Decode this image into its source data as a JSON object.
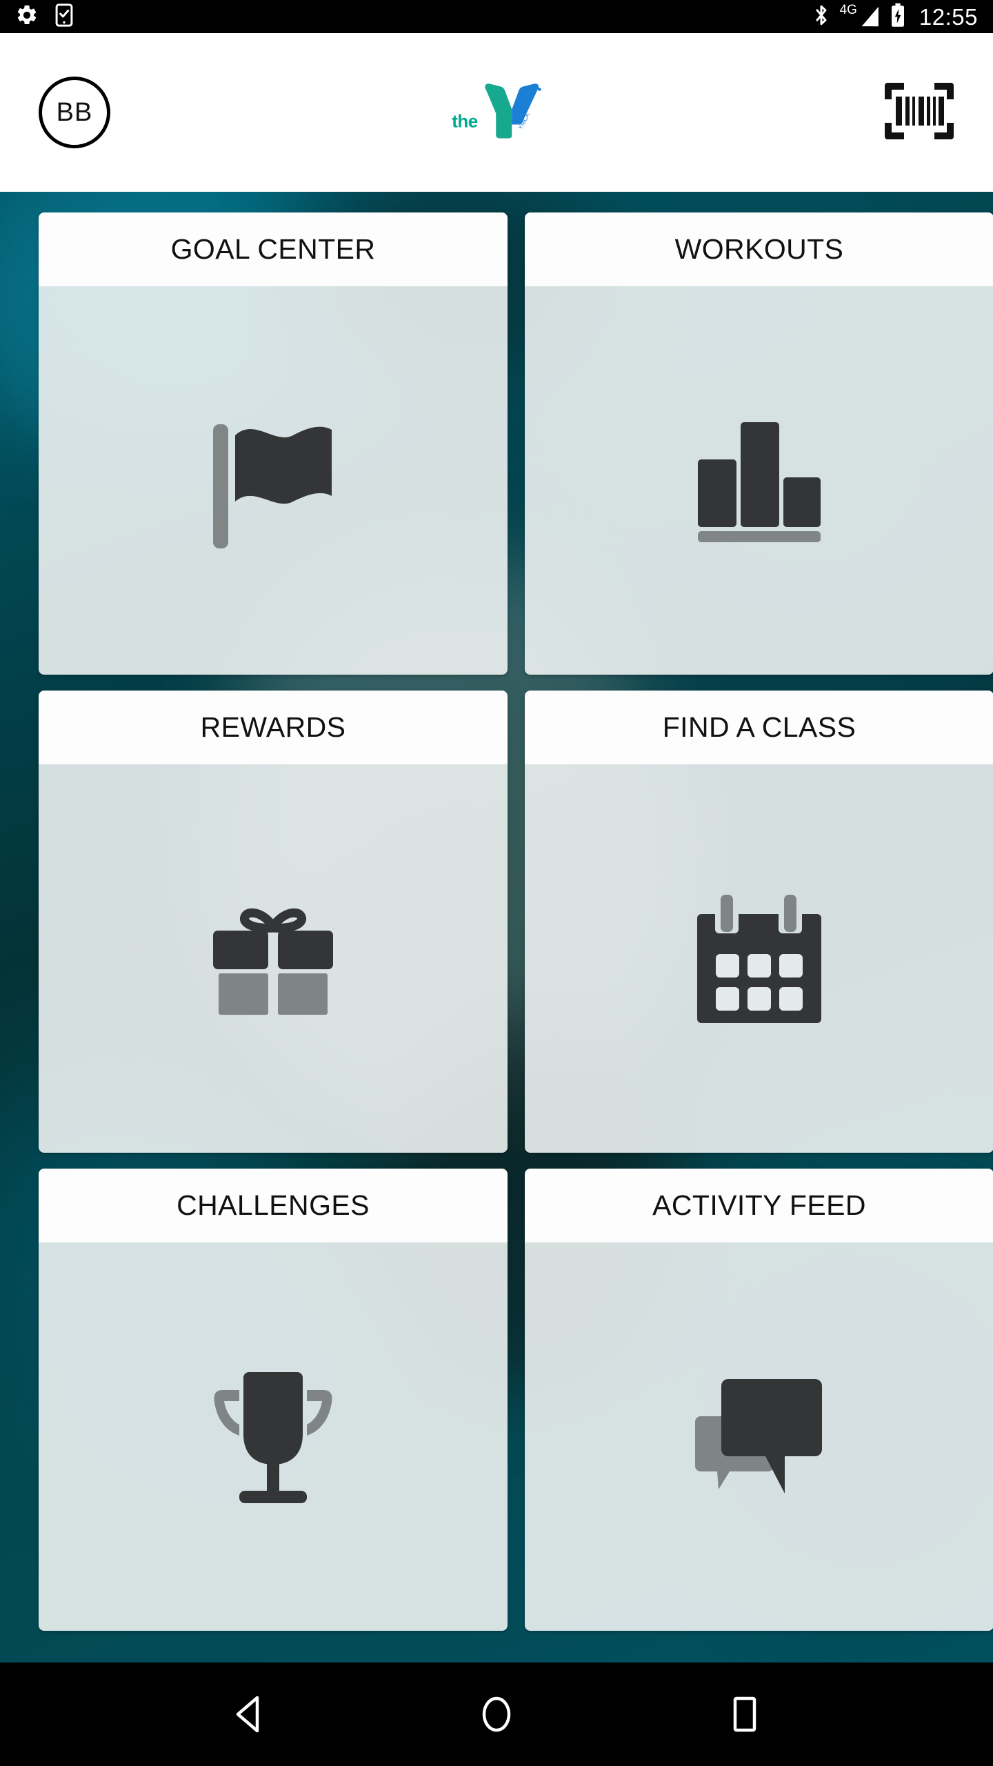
{
  "status_bar": {
    "time": "12:55",
    "network_label": "4G",
    "left_icons": [
      "settings-gear-icon",
      "phone-checkmark-icon"
    ],
    "right_icons": [
      "bluetooth-icon",
      "signal-bars-icon",
      "battery-charging-icon"
    ]
  },
  "app_header": {
    "avatar_initials": "BB",
    "logo": {
      "the_text": "the",
      "mark_text": "YMCA",
      "teal": "#00a890",
      "blue": "#1c7fd6"
    },
    "scan_icon_name": "barcode-scan-icon"
  },
  "theme": {
    "card_header_bg": "#fdfdfd",
    "card_body_bg": "#edf2f2",
    "icon_dark": "#333333",
    "icon_gray": "#808080",
    "background_teal": "#02505e"
  },
  "cards": [
    {
      "title": "GOAL CENTER",
      "icon": "flag-icon"
    },
    {
      "title": "WORKOUTS",
      "icon": "bar-chart-icon"
    },
    {
      "title": "REWARDS",
      "icon": "gift-icon"
    },
    {
      "title": "FIND A CLASS",
      "icon": "calendar-icon"
    },
    {
      "title": "CHALLENGES",
      "icon": "trophy-icon"
    },
    {
      "title": "ACTIVITY FEED",
      "icon": "chat-bubbles-icon"
    }
  ],
  "nav_bar": {
    "back_label": "Back",
    "home_label": "Home",
    "recents_label": "Recents"
  }
}
